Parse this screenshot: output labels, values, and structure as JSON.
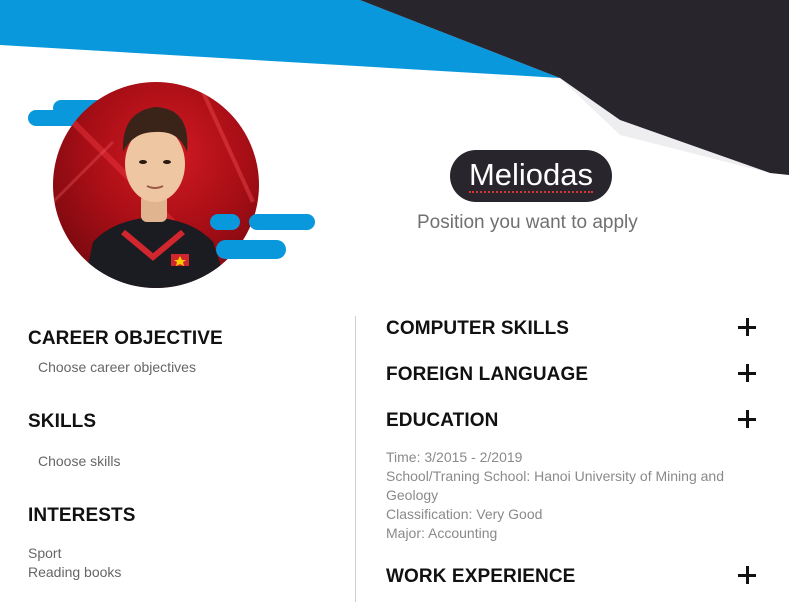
{
  "profile": {
    "name": "Meliodas",
    "position": "Position you want to apply"
  },
  "left": {
    "career_objective": {
      "title": "CAREER OBJECTIVE",
      "text": "Choose career objectives"
    },
    "skills": {
      "title": "SKILLS",
      "text": "Choose skills"
    },
    "interests": {
      "title": "INTERESTS",
      "items": [
        "Sport",
        "Reading books"
      ]
    }
  },
  "right": {
    "computer_skills": {
      "title": "COMPUTER SKILLS"
    },
    "foreign_language": {
      "title": "FOREIGN LANGUAGE"
    },
    "education": {
      "title": "EDUCATION",
      "lines": [
        "Time: 3/2015 - 2/2019",
        "School/Traning School: Hanoi University of Mining and Geology",
        "Classification: Very Good",
        "Major: Accounting"
      ]
    },
    "work_experience": {
      "title": "WORK EXPERIENCE"
    }
  },
  "icons": {
    "add": "plus-icon"
  },
  "colors": {
    "accent_blue": "#0a98dd",
    "dark": "#28252d",
    "muted_text": "#666666"
  }
}
